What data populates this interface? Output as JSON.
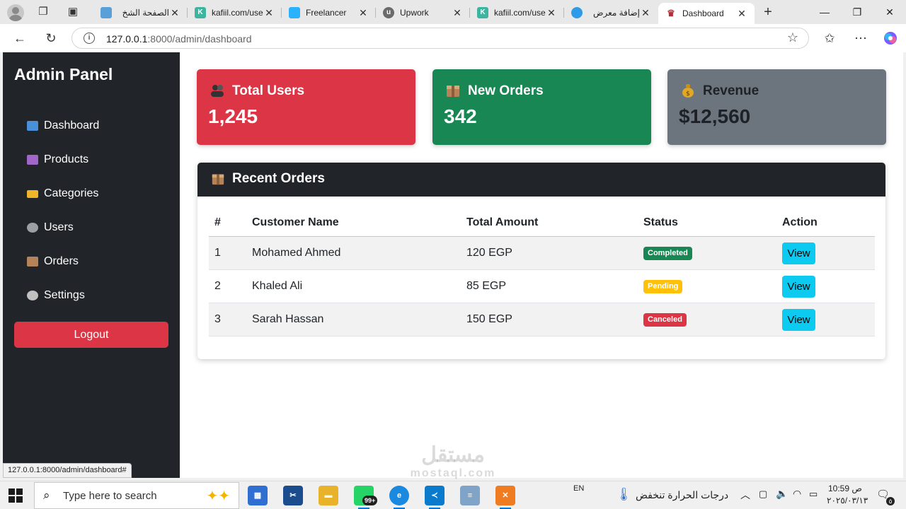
{
  "browser": {
    "tabs": [
      {
        "title": "الصفحة الشخ",
        "icon": "site-icon"
      },
      {
        "title": "kafiil.com/use",
        "icon": "kafiil-icon"
      },
      {
        "title": "Freelancer",
        "icon": "freelancer-icon"
      },
      {
        "title": "Upwork",
        "icon": "upwork-icon"
      },
      {
        "title": "kafiil.com/use",
        "icon": "kafiil-icon"
      },
      {
        "title": "إضافة معرض",
        "icon": "site-icon"
      },
      {
        "title": "Dashboard",
        "icon": "dashboard-icon",
        "active": true
      }
    ],
    "url_host": "127.0.0.1",
    "url_path": ":8000/admin/dashboard",
    "status_url": "127.0.0.1:8000/admin/dashboard#"
  },
  "sidebar": {
    "brand": "Admin Panel",
    "items": [
      {
        "label": "Dashboard",
        "icon": "chart-icon",
        "color": "#4a90d9"
      },
      {
        "label": "Products",
        "icon": "shopping-bags-icon",
        "color": "#a066c8"
      },
      {
        "label": "Categories",
        "icon": "folder-icon",
        "color": "#f0b429"
      },
      {
        "label": "Users",
        "icon": "users-icon",
        "color": "#9aa0a6"
      },
      {
        "label": "Orders",
        "icon": "package-icon",
        "color": "#b5835a"
      },
      {
        "label": "Settings",
        "icon": "gear-icon",
        "color": "#c0c0c0"
      }
    ],
    "logout_label": "Logout"
  },
  "cards": [
    {
      "title": "Total Users",
      "value": "1,245",
      "icon": "users-icon",
      "color": "#dc3545"
    },
    {
      "title": "New Orders",
      "value": "342",
      "icon": "package-icon",
      "color": "#198754"
    },
    {
      "title": "Revenue",
      "value": "$12,560",
      "icon": "money-bag-icon",
      "color": "#6c757d"
    }
  ],
  "orders": {
    "title": "Recent Orders",
    "columns": [
      "#",
      "Customer Name",
      "Total Amount",
      "Status",
      "Action"
    ],
    "rows": [
      {
        "id": "1",
        "customer": "Mohamed Ahmed",
        "amount": "120 EGP",
        "status": "Completed",
        "status_color": "#198754",
        "action": "View"
      },
      {
        "id": "2",
        "customer": "Khaled Ali",
        "amount": "85 EGP",
        "status": "Pending",
        "status_color": "#ffc107",
        "action": "View"
      },
      {
        "id": "3",
        "customer": "Sarah Hassan",
        "amount": "150 EGP",
        "status": "Canceled",
        "status_color": "#dc3545",
        "action": "View"
      }
    ]
  },
  "watermark": {
    "main": "مستقل",
    "sub": "mostaql.com"
  },
  "taskbar": {
    "search_placeholder": "Type here to search",
    "apps": [
      "microsoft-store-icon",
      "snipping-tool-icon",
      "file-explorer-icon",
      "whatsapp-icon",
      "edge-icon",
      "vscode-icon",
      "notepad-icon",
      "xampp-icon"
    ],
    "whatsapp_badge": "99+",
    "lang": "EN",
    "weather": "درجات الحرارة تنخفض",
    "time": "10:59",
    "ampm": "ص",
    "date": "٢٠٢٥/٠٣/١٣",
    "notifications": "٥"
  }
}
